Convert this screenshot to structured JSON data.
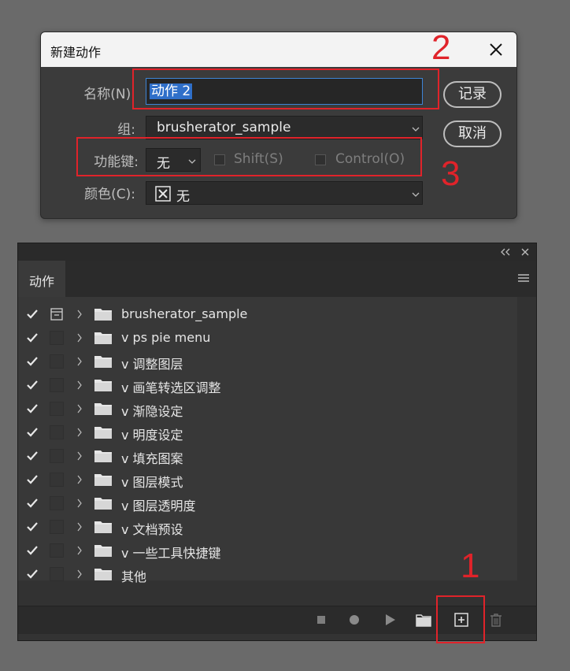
{
  "dialog": {
    "title": "新建动作",
    "name_label": "名称(N):",
    "name_value": "动作 2",
    "group_label": "组:",
    "group_value": "brusherator_sample",
    "fkey_label": "功能键:",
    "fkey_value": "无",
    "shift_label": "Shift(S)",
    "control_label": "Control(O)",
    "color_label": "颜色(C):",
    "color_value": "无",
    "record_button": "记录",
    "cancel_button": "取消"
  },
  "annotations": {
    "n1": "1",
    "n2": "2",
    "n3": "3",
    "color": "#e0232a"
  },
  "panel": {
    "tab_label": "动作",
    "actions": [
      {
        "label": "brusherator_sample",
        "checked": true
      },
      {
        "label": "v ps pie menu",
        "checked": true
      },
      {
        "label": "v 调整图层",
        "checked": true
      },
      {
        "label": "v 画笔转选区调整",
        "checked": true
      },
      {
        "label": "v 渐隐设定",
        "checked": true
      },
      {
        "label": "v 明度设定",
        "checked": true
      },
      {
        "label": "v 填充图案",
        "checked": true
      },
      {
        "label": "v 图层模式",
        "checked": true
      },
      {
        "label": "v 图层透明度",
        "checked": true
      },
      {
        "label": "v 文档预设",
        "checked": true
      },
      {
        "label": "v 一些工具快捷键",
        "checked": true
      },
      {
        "label": "其他",
        "checked": true
      }
    ],
    "toolbar_icons": [
      "stop-icon",
      "record-icon",
      "play-icon",
      "new-set-folder-icon",
      "new-action-icon",
      "delete-icon"
    ]
  },
  "colors": {
    "accent_blue": "#2f6fc9",
    "annotation_red": "#e0232a"
  }
}
